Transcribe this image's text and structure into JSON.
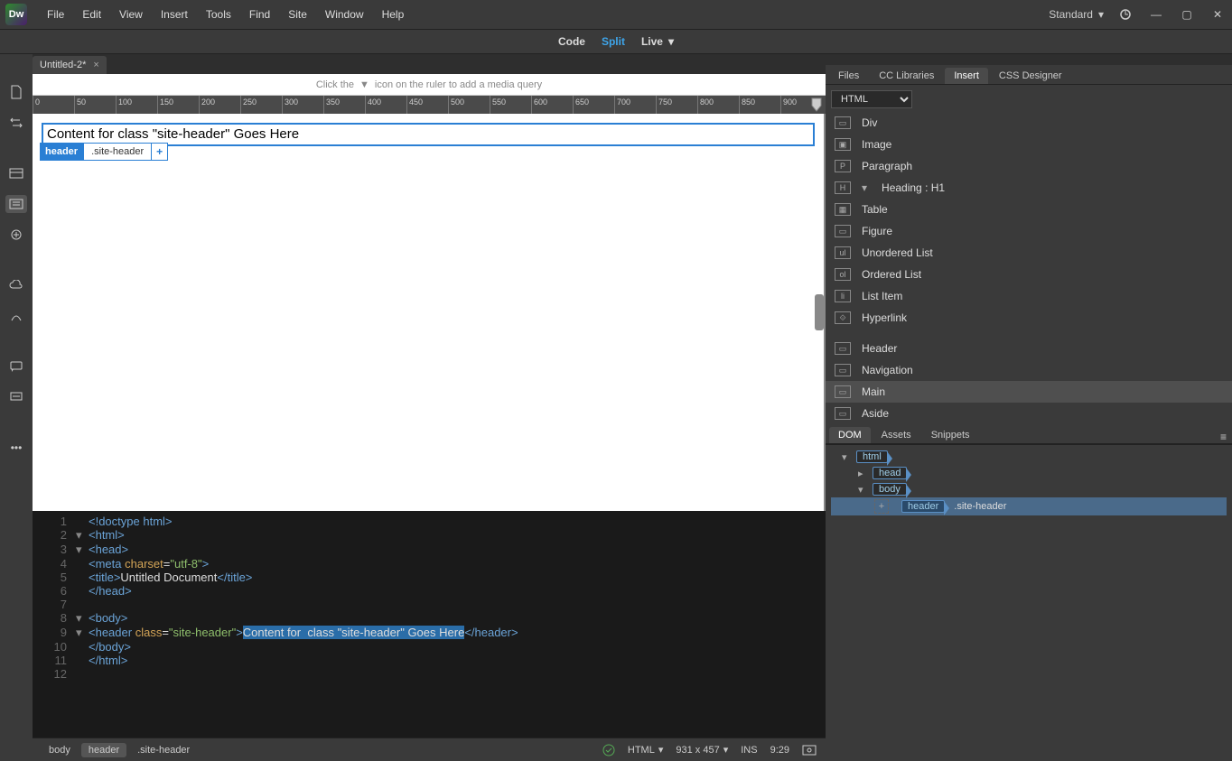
{
  "app": {
    "icon_text": "Dw"
  },
  "menubar": {
    "items": [
      "File",
      "Edit",
      "View",
      "Insert",
      "Tools",
      "Find",
      "Site",
      "Window",
      "Help"
    ],
    "workspace": "Standard"
  },
  "viewmode": {
    "code": "Code",
    "split": "Split",
    "live": "Live",
    "active": "Split"
  },
  "tab": {
    "name": "Untitled-2*"
  },
  "mq_hint": {
    "prefix": "Click the",
    "suffix": "icon on the ruler to add a media query"
  },
  "ruler_ticks": [
    "0",
    "50",
    "100",
    "150",
    "200",
    "250",
    "300",
    "350",
    "400",
    "450",
    "500",
    "550",
    "600",
    "650",
    "700",
    "750",
    "800",
    "850",
    "900"
  ],
  "live_header": {
    "content": "Content for class \"site-header\" Goes Here",
    "tagname": "header",
    "classname": ".site-header",
    "add": "+"
  },
  "code_lines": [
    {
      "n": 1,
      "fold": "",
      "html": "<span class='t-tag'>&lt;!doctype html&gt;</span>"
    },
    {
      "n": 2,
      "fold": "▾",
      "html": "<span class='t-tag'>&lt;html&gt;</span>"
    },
    {
      "n": 3,
      "fold": "▾",
      "html": "<span class='t-tag'>&lt;head&gt;</span>"
    },
    {
      "n": 4,
      "fold": "",
      "html": "<span class='t-tag'>&lt;meta</span> <span class='t-attr'>charset</span>=<span class='t-str'>\"utf-8\"</span><span class='t-tag'>&gt;</span>"
    },
    {
      "n": 5,
      "fold": "",
      "html": "<span class='t-tag'>&lt;title&gt;</span><span class='t-text'>Untitled Document</span><span class='t-tag'>&lt;/title&gt;</span>"
    },
    {
      "n": 6,
      "fold": "",
      "html": "<span class='t-tag'>&lt;/head&gt;</span>"
    },
    {
      "n": 7,
      "fold": "",
      "html": ""
    },
    {
      "n": 8,
      "fold": "▾",
      "html": "<span class='t-tag'>&lt;body&gt;</span>"
    },
    {
      "n": 9,
      "fold": "▾",
      "html": "<span class='t-tag'>&lt;header</span> <span class='t-attr'>class</span>=<span class='t-str'>\"site-header\"</span><span class='t-tag'>&gt;</span><span class='t-sel'>Content for  class \"site-header\" Goes Here</span><span class='t-tag'>&lt;/header&gt;</span>"
    },
    {
      "n": 10,
      "fold": "",
      "html": "<span class='t-tag'>&lt;/body&gt;</span>"
    },
    {
      "n": 11,
      "fold": "",
      "html": "<span class='t-tag'>&lt;/html&gt;</span>"
    },
    {
      "n": 12,
      "fold": "",
      "html": ""
    }
  ],
  "status": {
    "crumbs": [
      "body",
      "header",
      ".site-header"
    ],
    "active_crumb": 1,
    "doctype": "HTML",
    "dims": "931 x 457",
    "ins": "INS",
    "pos": "9:29"
  },
  "right": {
    "top_tabs": [
      "Files",
      "CC Libraries",
      "Insert",
      "CSS Designer"
    ],
    "top_active": 2,
    "insert_category": "HTML",
    "insert_items": [
      {
        "icon": "▭",
        "label": "Div"
      },
      {
        "icon": "▣",
        "label": "Image"
      },
      {
        "icon": "P",
        "label": "Paragraph"
      },
      {
        "icon": "H",
        "label": "Heading : H1",
        "dropdown": true
      },
      {
        "icon": "▦",
        "label": "Table"
      },
      {
        "icon": "▭",
        "label": "Figure"
      },
      {
        "icon": "ul",
        "label": "Unordered List"
      },
      {
        "icon": "ol",
        "label": "Ordered List"
      },
      {
        "icon": "li",
        "label": "List Item"
      },
      {
        "icon": "⟐",
        "label": "Hyperlink"
      }
    ],
    "insert_items2": [
      {
        "icon": "▭",
        "label": "Header"
      },
      {
        "icon": "▭",
        "label": "Navigation"
      },
      {
        "icon": "▭",
        "label": "Main",
        "hover": true
      },
      {
        "icon": "▭",
        "label": "Aside"
      }
    ],
    "bottom_tabs": [
      "DOM",
      "Assets",
      "Snippets"
    ],
    "bottom_active": 0,
    "dom": {
      "html": "html",
      "head": "head",
      "body": "body",
      "header": "header",
      "header_class": ".site-header"
    }
  }
}
